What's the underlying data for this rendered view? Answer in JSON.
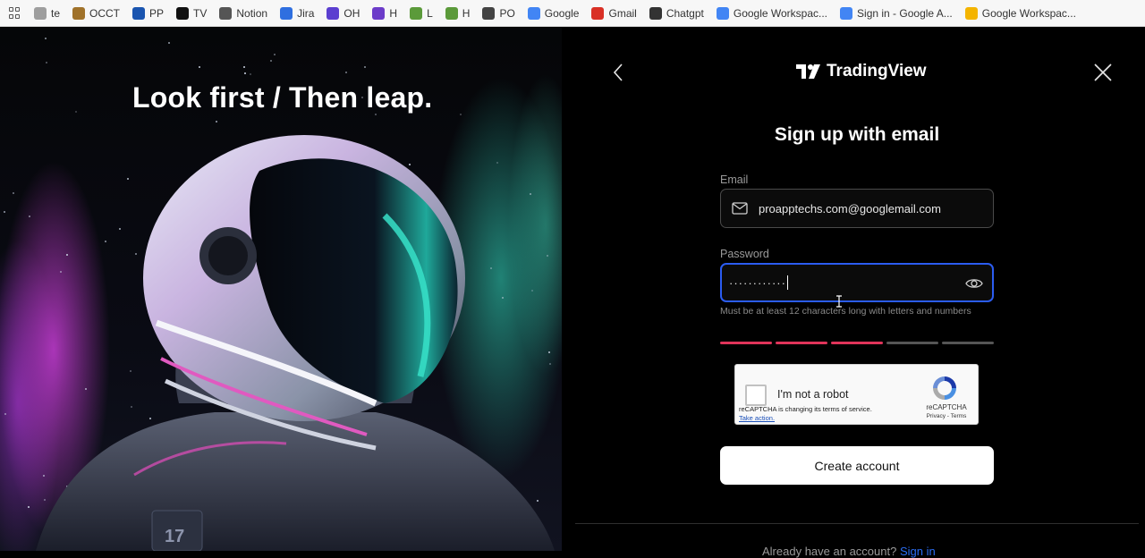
{
  "bookmarks": [
    {
      "label": "te",
      "icon": "pencil-icon",
      "color": "#9e9e9e"
    },
    {
      "label": "OCCT",
      "icon": "box-icon",
      "color": "#a0722a"
    },
    {
      "label": "PP",
      "icon": "paypal-icon",
      "color": "#1a55b0"
    },
    {
      "label": "TV",
      "icon": "tradingview-icon",
      "color": "#111111"
    },
    {
      "label": "Notion",
      "icon": "home-icon",
      "color": "#555555"
    },
    {
      "label": "Jira",
      "icon": "jira-icon",
      "color": "#2f6fe0"
    },
    {
      "label": "OH",
      "icon": "ring-icon",
      "color": "#5b3fd0"
    },
    {
      "label": "H",
      "icon": "s-icon",
      "color": "#6c3cc9"
    },
    {
      "label": "L",
      "icon": "shopify-icon",
      "color": "#5b9a3a"
    },
    {
      "label": "H",
      "icon": "shopify-icon",
      "color": "#5b9a3a"
    },
    {
      "label": "PO",
      "icon": "globe-icon",
      "color": "#444444"
    },
    {
      "label": "Google",
      "icon": "google-icon",
      "color": "#4285f4"
    },
    {
      "label": "Gmail",
      "icon": "gmail-icon",
      "color": "#d93025"
    },
    {
      "label": "Chatgpt",
      "icon": "openai-icon",
      "color": "#333333"
    },
    {
      "label": "Google Workspac...",
      "icon": "google-icon",
      "color": "#4285f4"
    },
    {
      "label": "Sign in - Google A...",
      "icon": "google-icon",
      "color": "#4285f4"
    },
    {
      "label": "Google Workspac...",
      "icon": "slides-icon",
      "color": "#f4b400"
    }
  ],
  "hero": {
    "title": "Look first / Then leap."
  },
  "panel": {
    "logo_text": "TradingView",
    "heading": "Sign up with email",
    "email_label": "Email",
    "email_value": "proapptechs.com@googlemail.com",
    "password_label": "Password",
    "password_value": "············",
    "hint": "Must be at least 12 characters long with letters and numbers",
    "strength": {
      "filled": 3,
      "total": 5,
      "color": "#e0345a"
    },
    "captcha": {
      "label": "I'm not a robot",
      "brand": "reCAPTCHA",
      "links": "Privacy - Terms",
      "notice": "reCAPTCHA is changing its terms of service.",
      "notice_link": "Take action."
    },
    "create_button": "Create account",
    "signin_prefix": "Already have an account?",
    "signin_link": "Sign in"
  },
  "colors": {
    "accent_blue": "#2b5cf0",
    "strength_red": "#e0345a"
  }
}
